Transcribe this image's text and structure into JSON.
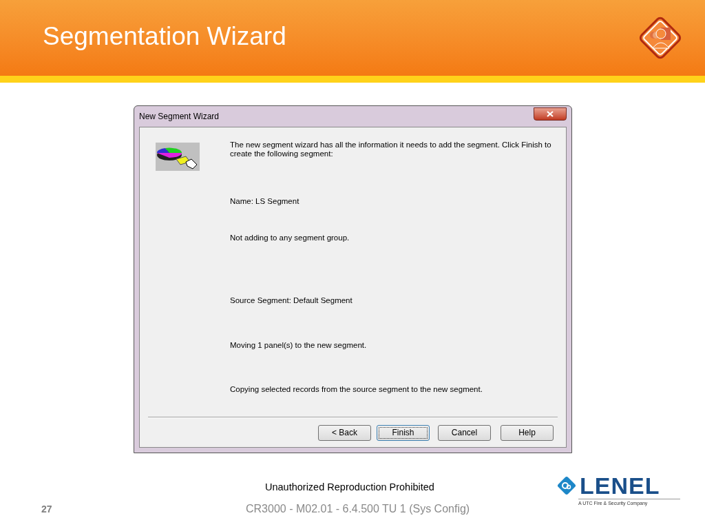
{
  "slide": {
    "title": "Segmentation Wizard",
    "number": "27"
  },
  "window": {
    "title": "New Segment Wizard",
    "lines": [
      "The new segment wizard has all the information it needs to add the segment. Click Finish to create the following segment:",
      "Name:  LS Segment",
      "Not adding to any segment group.",
      "Source Segment:  Default Segment",
      "Moving 1 panel(s) to the new segment.",
      "Copying selected records from the source segment to the new segment."
    ],
    "buttons": [
      {
        "label": "< Back",
        "default": false
      },
      {
        "label": "Finish",
        "default": true
      },
      {
        "label": "Cancel",
        "default": false
      },
      {
        "label": "Help",
        "default": false
      }
    ]
  },
  "footer": {
    "notice": "Unauthorized Reproduction Prohibited",
    "course": "CR3000 - M02.01 - 6.4.500 TU 1 (Sys Config)"
  },
  "logo": {
    "word": "LENEL",
    "tagline": "A UTC Fire & Security Company"
  }
}
